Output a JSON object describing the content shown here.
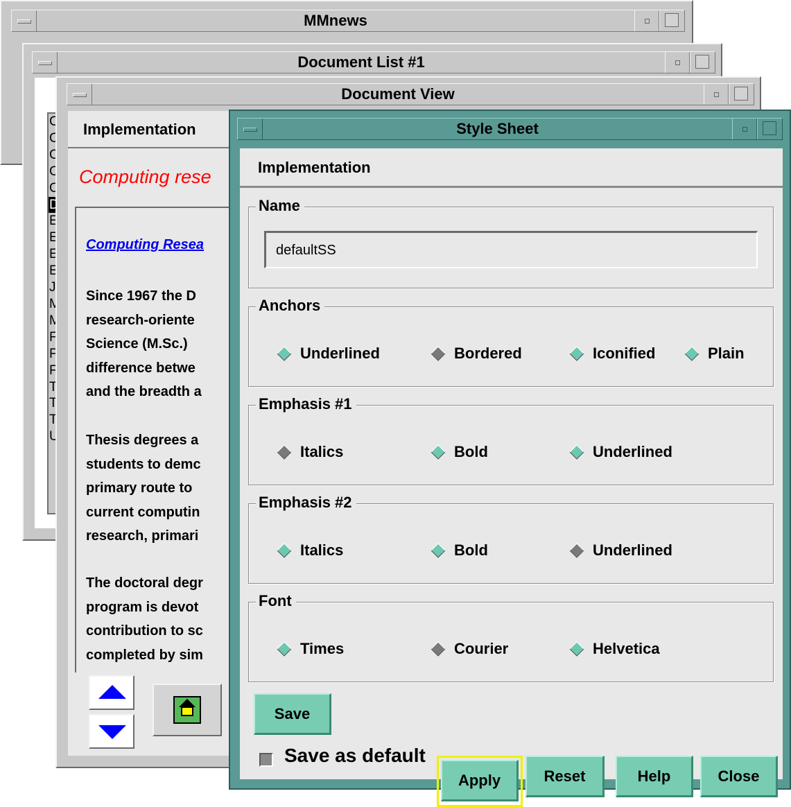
{
  "windows": {
    "mmnews": {
      "title": "MMnews"
    },
    "doc_list": {
      "title": "Document List #1",
      "items": [
        "C",
        "C",
        "C",
        "C",
        "C",
        "D",
        "E",
        "E",
        "E",
        "E",
        "J",
        "M",
        "M",
        "F",
        "F",
        "F",
        "T",
        "T",
        "T",
        "U"
      ],
      "selected_index": 5
    },
    "doc_view": {
      "title": "Document View",
      "header": "Implementation",
      "red_heading": "Computing rese",
      "link": "Computing Resea",
      "paragraphs": [
        [
          "Since 1967 the D",
          "research-oriente",
          "Science (M.Sc.)",
          "difference betwe",
          "and the breadth a"
        ],
        [
          "Thesis degrees a",
          "students to demc",
          "primary route to",
          "current computin",
          "research, primari"
        ],
        [
          "The doctoral degr",
          "program is devot",
          "contribution to sc",
          "completed by sim"
        ]
      ]
    }
  },
  "style_sheet": {
    "title": "Style Sheet",
    "header": "Implementation",
    "name_group": {
      "label": "Name",
      "value": "defaultSS"
    },
    "groups": [
      {
        "label": "Anchors",
        "options": [
          "Underlined",
          "Bordered",
          "Iconified",
          "Plain"
        ],
        "selected": 1
      },
      {
        "label": "Emphasis #1",
        "options": [
          "Italics",
          "Bold",
          "Underlined"
        ],
        "selected": 0
      },
      {
        "label": "Emphasis #2",
        "options": [
          "Italics",
          "Bold",
          "Underlined"
        ],
        "selected": 2
      },
      {
        "label": "Font",
        "options": [
          "Times",
          "Courier",
          "Helvetica"
        ],
        "selected": 1
      }
    ],
    "buttons": {
      "save": "Save",
      "apply": "Apply",
      "reset": "Reset",
      "help": "Help",
      "close": "Close"
    },
    "save_default": {
      "label": "Save as default",
      "checked": true
    }
  },
  "colors": {
    "motif_grey": "#c8c8c8",
    "panel_grey": "#e8e8e8",
    "teal_frame": "#5a9a94",
    "button_teal": "#78ccb2",
    "radio_on": "#7a7a7a",
    "radio_off": "#6cc8b0",
    "focus_yellow": "#f0f000",
    "link_blue": "#0000ee",
    "heading_red": "#ff0000"
  }
}
